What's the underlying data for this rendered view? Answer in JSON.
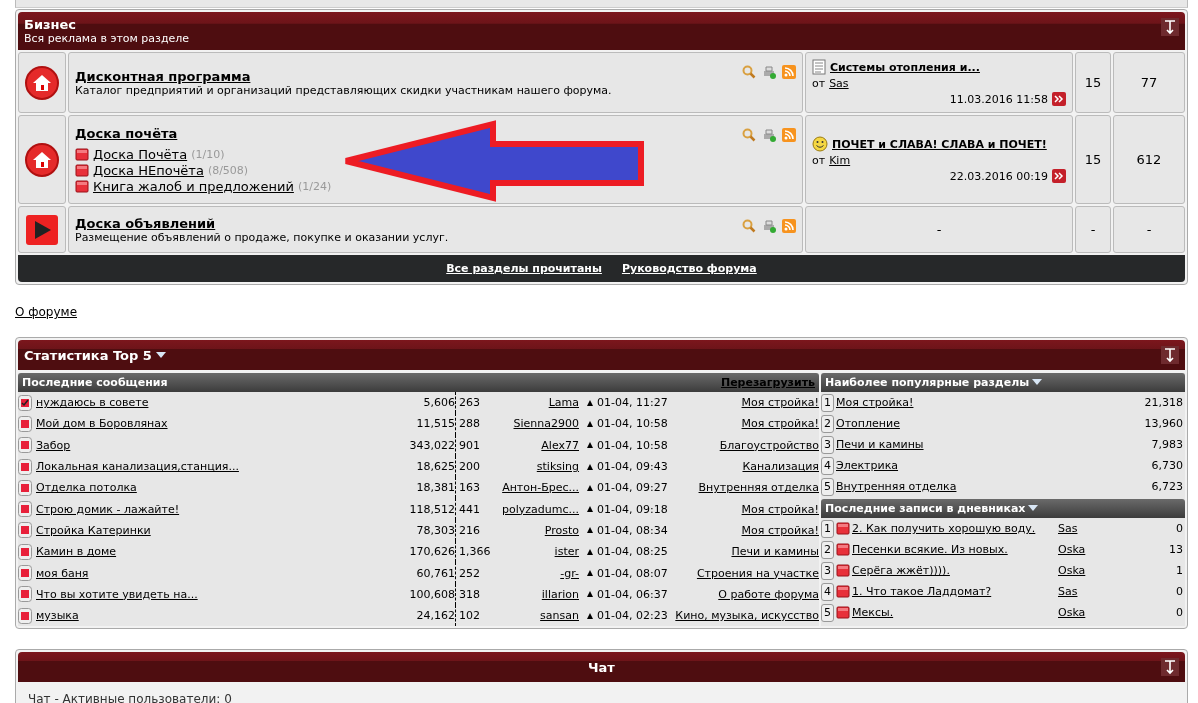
{
  "business": {
    "title": "Бизнес",
    "subtitle": "Вся реклама в этом разделе",
    "forums": [
      {
        "kind": "forum",
        "title": "Дисконтная программа",
        "description": "Каталог предприятий и организаций представляющих скидки участникам нашего форума.",
        "last_post": {
          "kind": "document",
          "title": "Системы отопления и...",
          "by": "от",
          "author": "Sas",
          "date": "11.03.2016 11:58"
        },
        "topics": "15",
        "posts": "77"
      },
      {
        "kind": "forum",
        "title": "Доска почёта",
        "subforums": [
          {
            "title": "Доска Почёта",
            "count": "(1/10)"
          },
          {
            "title": "Доска НЕпочёта",
            "count": "(8/508)"
          },
          {
            "title": "Книга жалоб и предложений",
            "count": "(1/24)"
          }
        ],
        "last_post": {
          "kind": "smiley",
          "title": "ПОЧЕТ и СЛАВА! СЛАВА и ПОЧЕТ!",
          "by": "от",
          "author": "Kim",
          "date": "22.03.2016 00:19"
        },
        "topics": "15",
        "posts": "612"
      },
      {
        "kind": "link",
        "title": "Доска объявлений",
        "description": "Размещение объявлений о продаже, покупке и оказании услуг.",
        "last_post": {
          "kind": "empty",
          "text": "-"
        },
        "topics": "-",
        "posts": "-"
      }
    ],
    "footer_links": [
      "Все разделы прочитаны",
      "Руководство форума"
    ]
  },
  "about_link": "О форуме",
  "stats": {
    "title": "Статистика Top 5",
    "recent": {
      "title": "Последние сообщения",
      "reload": "Перезагрузить",
      "rows": [
        {
          "title": "нуждаюсь в совете",
          "views": "5,606",
          "replies": "263",
          "author": "Lama",
          "time": "01-04, 11:27",
          "forum": "Моя стройка!",
          "posted": true
        },
        {
          "title": "Мой дом в Боровлянах",
          "views": "11,515",
          "replies": "288",
          "author": "Sienna2900",
          "time": "01-04, 10:58",
          "forum": "Моя стройка!",
          "posted": false
        },
        {
          "title": "Забор",
          "views": "343,022",
          "replies": "901",
          "author": "Alex77",
          "time": "01-04, 10:58",
          "forum": "Благоустройство",
          "posted": false
        },
        {
          "title": "Локальная канализация,станция...",
          "views": "18,625",
          "replies": "200",
          "author": "stiksing",
          "time": "01-04, 09:43",
          "forum": "Канализация",
          "posted": false
        },
        {
          "title": "Отделка потолка",
          "views": "18,381",
          "replies": "163",
          "author": "Антон-Брес...",
          "time": "01-04, 09:27",
          "forum": "Внутренняя отделка",
          "posted": false
        },
        {
          "title": "Строю домик - лажайте!",
          "views": "118,512",
          "replies": "441",
          "author": "polyzadumc...",
          "time": "01-04, 09:18",
          "forum": "Моя стройка!",
          "posted": false
        },
        {
          "title": "Стройка Катеринки",
          "views": "78,303",
          "replies": "216",
          "author": "Prosto",
          "time": "01-04, 08:34",
          "forum": "Моя стройка!",
          "posted": false
        },
        {
          "title": "Камин в доме",
          "views": "170,626",
          "replies": "1,366",
          "author": "ister",
          "time": "01-04, 08:25",
          "forum": "Печи и камины",
          "posted": false
        },
        {
          "title": "моя баня",
          "views": "60,761",
          "replies": "252",
          "author": "-gr-",
          "time": "01-04, 08:07",
          "forum": "Строения на участке",
          "posted": false
        },
        {
          "title": "Что вы хотите увидеть на...",
          "views": "100,608",
          "replies": "318",
          "author": "illarion",
          "time": "01-04, 06:37",
          "forum": "О работе форума",
          "posted": false
        },
        {
          "title": "музыка",
          "views": "24,162",
          "replies": "102",
          "author": "sansan",
          "time": "01-04, 02:23",
          "forum": "Кино, музыка, искусство",
          "posted": false
        }
      ]
    },
    "popular": {
      "title": "Наиболее популярные разделы",
      "rows": [
        {
          "rank": "1",
          "name": "Моя стройка!",
          "count": "21,318"
        },
        {
          "rank": "2",
          "name": "Отопление",
          "count": "13,960"
        },
        {
          "rank": "3",
          "name": "Печи и камины",
          "count": "7,983"
        },
        {
          "rank": "4",
          "name": "Электрика",
          "count": "6,730"
        },
        {
          "rank": "5",
          "name": "Внутренняя отделка",
          "count": "6,723"
        }
      ]
    },
    "diaries": {
      "title": "Последние записи в дневниках",
      "rows": [
        {
          "rank": "1",
          "title": "2. Как получить хорошую воду.",
          "author": "Sas",
          "comments": "0"
        },
        {
          "rank": "2",
          "title": "Песенки всякие. Из новых.",
          "author": "Oska",
          "comments": "13"
        },
        {
          "rank": "3",
          "title": "Серёга жжёт)))).",
          "author": "Oska",
          "comments": "1"
        },
        {
          "rank": "4",
          "title": "1. Что такое Ладдомат?",
          "author": "Sas",
          "comments": "0"
        },
        {
          "rank": "5",
          "title": "Мексы.",
          "author": "Oska",
          "comments": "0"
        }
      ]
    }
  },
  "chat": {
    "title": "Чат",
    "status": "Чат - Активные пользователи: 0"
  }
}
